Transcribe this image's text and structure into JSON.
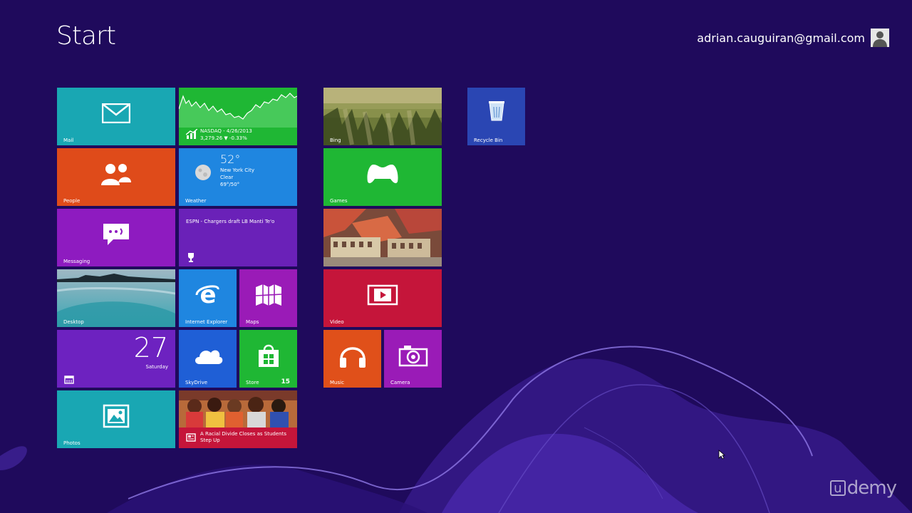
{
  "screen": {
    "title": "Start",
    "user": {
      "email": "adrian.cauguiran@gmail.com",
      "avatar_icon": "user-silhouette-icon"
    }
  },
  "tiles": {
    "mail": {
      "label": "Mail",
      "icon": "envelope-icon",
      "color": "#19a7b3"
    },
    "finance": {
      "line1": "NASDAQ - 4/26/2013",
      "line2": "3,279.26 ▼ -0.33%",
      "color": "#1fb734"
    },
    "bing": {
      "label": "Bing"
    },
    "recycle_bin": {
      "label": "Recycle Bin",
      "icon": "recycle-bin-icon"
    },
    "people": {
      "label": "People",
      "icon": "people-icon",
      "color": "#df4b1a"
    },
    "weather": {
      "label": "Weather",
      "temp": "52°",
      "city": "New York City",
      "condition": "Clear",
      "range": "69°/50°",
      "color": "#1f86e0"
    },
    "games": {
      "label": "Games",
      "icon": "xbox-controller-icon",
      "color": "#1fb734"
    },
    "messaging": {
      "label": "Messaging",
      "icon": "chat-bubble-icon",
      "color": "#8e1bc0"
    },
    "sports": {
      "headline": "ESPN - Chargers draft LB Manti Te'o",
      "icon": "trophy-icon",
      "color": "#6a21b8"
    },
    "travel": {
      "label": ""
    },
    "desktop": {
      "label": "Desktop"
    },
    "internet_explorer": {
      "label": "Internet Explorer",
      "icon": "ie-logo-icon"
    },
    "maps": {
      "label": "Maps",
      "icon": "map-icon"
    },
    "video": {
      "label": "Video",
      "icon": "play-screen-icon",
      "color": "#c5153a"
    },
    "calendar": {
      "day": "27",
      "weekday": "Saturday",
      "icon": "calendar-icon"
    },
    "skydrive": {
      "label": "SkyDrive",
      "icon": "cloud-icon"
    },
    "store": {
      "label": "Store",
      "badge": "15",
      "icon": "shopping-bag-icon"
    },
    "music": {
      "label": "Music",
      "icon": "headphones-icon"
    },
    "camera": {
      "label": "Camera",
      "icon": "camera-icon"
    },
    "photos": {
      "label": "Photos",
      "icon": "picture-icon"
    },
    "news": {
      "headline": "A Racial Divide Closes as Students Step Up",
      "icon": "news-icon"
    }
  },
  "watermark": {
    "text": "demy",
    "letter": "u"
  }
}
